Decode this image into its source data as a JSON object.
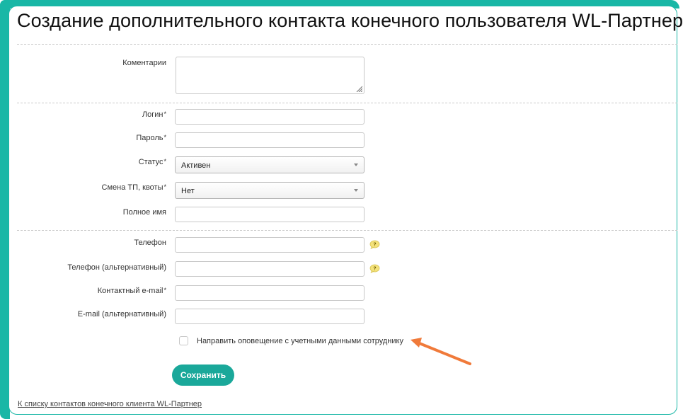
{
  "page": {
    "title": "Создание дополнительного контакта конечного пользователя WL-Партнер"
  },
  "form": {
    "comments": {
      "label": "Коментарии",
      "value": ""
    },
    "login": {
      "label": "Логин",
      "required_mark": "*",
      "value": ""
    },
    "password": {
      "label": "Пароль",
      "required_mark": "*",
      "value": ""
    },
    "status": {
      "label": "Статус",
      "required_mark": "*",
      "selected": "Активен"
    },
    "tariff_change": {
      "label": "Смена ТП, квоты",
      "required_mark": "*",
      "selected": "Нет"
    },
    "full_name": {
      "label": "Полное имя",
      "value": ""
    },
    "phone": {
      "label": "Телефон",
      "value": "",
      "help_icon": "question-bubble-icon"
    },
    "phone_alt": {
      "label": "Телефон (альтернативный)",
      "value": "",
      "help_icon": "question-bubble-icon"
    },
    "email": {
      "label": "Контактный e-mail",
      "required_mark": "*",
      "value": ""
    },
    "email_alt": {
      "label": "E-mail (альтернативный)",
      "value": ""
    },
    "notify": {
      "label": "Направить оповещение с учетными данными сотруднику",
      "checked": false
    },
    "save_label": "Сохранить"
  },
  "footer": {
    "back_link": "К списку контактов конечного клиента WL-Партнер"
  },
  "colors": {
    "accent": "#1aa89a",
    "frame": "#19b7a6",
    "annotation_arrow": "#f07a3a",
    "help_icon": "#f4e27a"
  }
}
